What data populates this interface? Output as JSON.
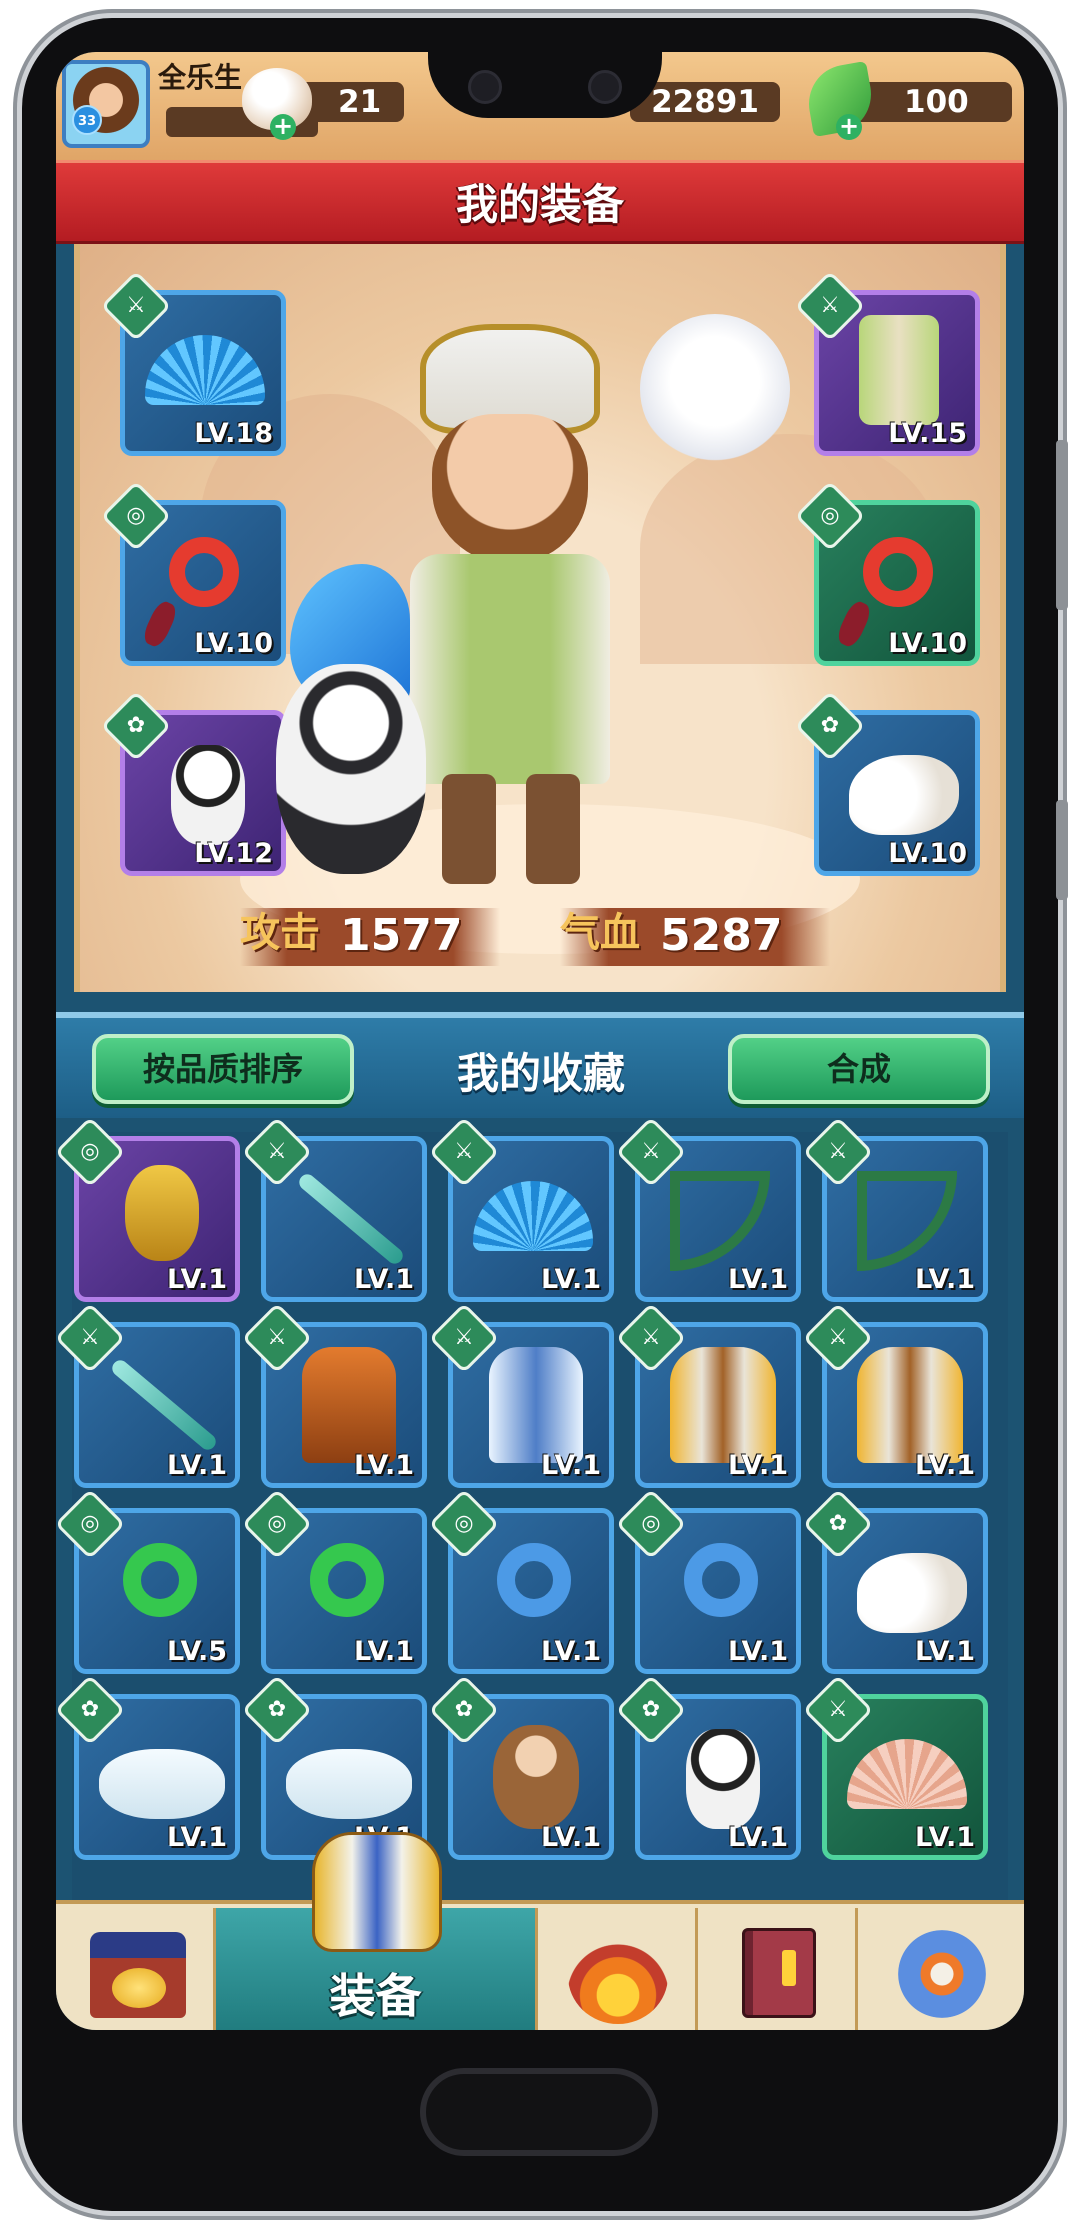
{
  "player": {
    "name": "全乐生",
    "level": "33"
  },
  "currencies": {
    "buns": "21",
    "gold": "22891",
    "leaves": "100"
  },
  "page_title": "我的装备",
  "equipped_slots": [
    {
      "item": "blue-fan",
      "level": "LV.18",
      "category": "weapon",
      "rarity": "blue"
    },
    {
      "item": "robe",
      "level": "LV.15",
      "category": "weapon",
      "rarity": "purple"
    },
    {
      "item": "jade-pendant",
      "level": "LV.10",
      "category": "accessory",
      "rarity": "blue"
    },
    {
      "item": "jade-pendant",
      "level": "LV.10",
      "category": "accessory",
      "rarity": "green"
    },
    {
      "item": "panda-pet",
      "level": "LV.12",
      "category": "pet",
      "rarity": "purple"
    },
    {
      "item": "squirrel-pet",
      "level": "LV.10",
      "category": "pet",
      "rarity": "blue"
    }
  ],
  "stats": {
    "attack_label": "攻击",
    "attack_value": "1577",
    "hp_label": "气血",
    "hp_value": "5287"
  },
  "collection": {
    "sort_button": "按品质排序",
    "title": "我的收藏",
    "synthesize_button": "合成",
    "items": [
      {
        "item": "gold-pendant",
        "level": "LV.1",
        "category": "accessory",
        "rarity": "purple"
      },
      {
        "item": "sword",
        "level": "LV.1",
        "category": "weapon",
        "rarity": "blue"
      },
      {
        "item": "blue-fan",
        "level": "LV.1",
        "category": "weapon",
        "rarity": "blue"
      },
      {
        "item": "crossbow",
        "level": "LV.1",
        "category": "weapon",
        "rarity": "blue"
      },
      {
        "item": "crossbow",
        "level": "LV.1",
        "category": "weapon",
        "rarity": "blue"
      },
      {
        "item": "sword",
        "level": "LV.1",
        "category": "weapon",
        "rarity": "blue"
      },
      {
        "item": "brown-robe",
        "level": "LV.1",
        "category": "weapon",
        "rarity": "blue"
      },
      {
        "item": "fur-robe",
        "level": "LV.1",
        "category": "weapon",
        "rarity": "blue"
      },
      {
        "item": "armor",
        "level": "LV.1",
        "category": "weapon",
        "rarity": "blue"
      },
      {
        "item": "armor",
        "level": "LV.1",
        "category": "weapon",
        "rarity": "blue"
      },
      {
        "item": "green-pendant",
        "level": "LV.5",
        "category": "accessory",
        "rarity": "blue"
      },
      {
        "item": "green-pendant",
        "level": "LV.1",
        "category": "accessory",
        "rarity": "blue"
      },
      {
        "item": "blue-pendant",
        "level": "LV.1",
        "category": "accessory",
        "rarity": "blue"
      },
      {
        "item": "blue-pendant",
        "level": "LV.1",
        "category": "accessory",
        "rarity": "blue"
      },
      {
        "item": "squirrel-pet",
        "level": "LV.1",
        "category": "pet",
        "rarity": "blue"
      },
      {
        "item": "ferret-pet",
        "level": "LV.1",
        "category": "pet",
        "rarity": "blue"
      },
      {
        "item": "ferret-pet",
        "level": "LV.1",
        "category": "pet",
        "rarity": "blue"
      },
      {
        "item": "monkey-pet",
        "level": "LV.1",
        "category": "pet",
        "rarity": "blue"
      },
      {
        "item": "panda-pet",
        "level": "LV.1",
        "category": "pet",
        "rarity": "blue"
      },
      {
        "item": "fan",
        "level": "LV.1",
        "category": "weapon",
        "rarity": "green"
      }
    ]
  },
  "nav": {
    "items": [
      {
        "icon": "shop-icon"
      },
      {
        "icon": "armor-icon",
        "label": "装备",
        "active": true
      },
      {
        "icon": "battle-icon"
      },
      {
        "icon": "book-icon"
      },
      {
        "icon": "settings-icon"
      }
    ]
  },
  "colors": {
    "rarity_blue": "#4ea6e8",
    "rarity_purple": "#b37fe8",
    "rarity_green": "#4fd39d",
    "banner_red": "#c8252b",
    "button_green": "#2bb26c"
  }
}
